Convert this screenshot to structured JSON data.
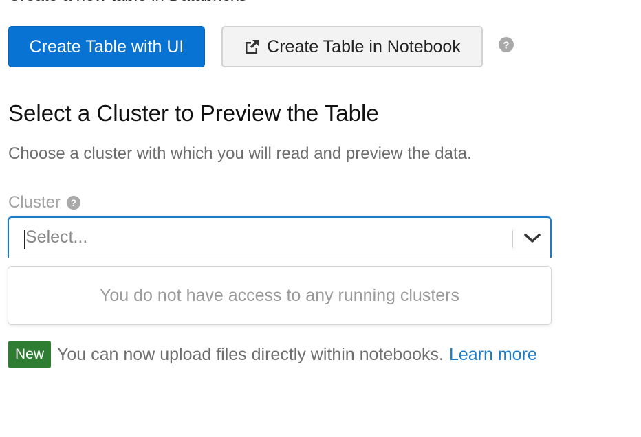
{
  "header": {
    "clipped_text": "Create a new table in Databricks"
  },
  "actions": {
    "primary_label": "Create Table with UI",
    "secondary_label": "Create Table in Notebook",
    "secondary_icon": "external-link-icon",
    "help_icon": "question-circle-icon"
  },
  "section": {
    "title": "Select a Cluster to Preview the Table",
    "description": "Choose a cluster with which you will read and preview the data."
  },
  "cluster_field": {
    "label": "Cluster",
    "label_icon": "question-circle-icon",
    "placeholder": "Select...",
    "chevron_icon": "chevron-down-icon",
    "no_options_message": "You do not have access to any running clusters"
  },
  "notice": {
    "badge": "New",
    "text": "You can now upload files directly within notebooks.",
    "link": "Learn more"
  },
  "colors": {
    "primary": "#0973d4",
    "focus_border": "#1a7bc9",
    "badge_green": "#2e7d32",
    "link": "#1a7bc9"
  }
}
